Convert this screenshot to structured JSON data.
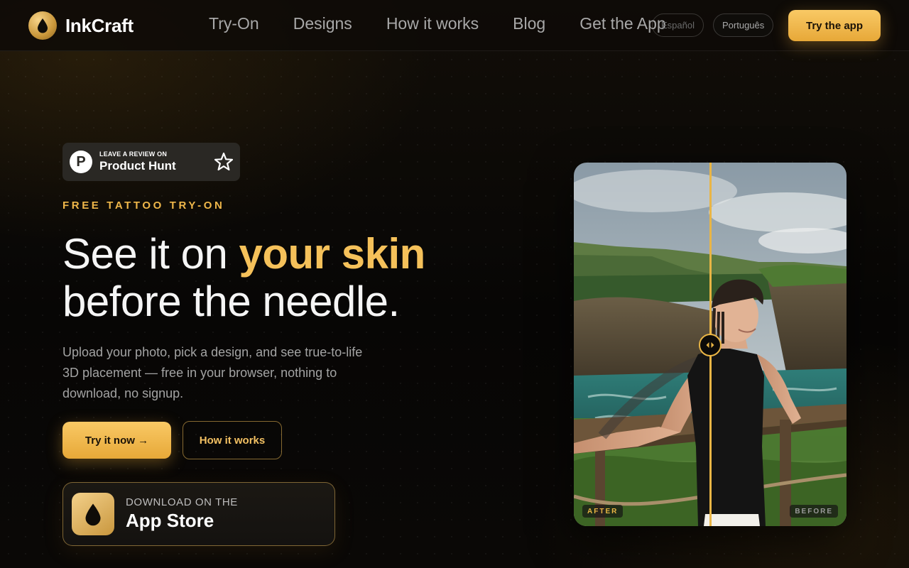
{
  "brand": {
    "name": "InkCraft",
    "icon": "ink-drop-icon"
  },
  "nav": {
    "links": [
      "Try-On",
      "Designs",
      "How it works",
      "Blog",
      "Get the App"
    ],
    "languages": [
      "Español",
      "Português"
    ],
    "cta": "Try the app"
  },
  "product_hunt": {
    "small": "LEAVE A REVIEW ON",
    "big": "Product Hunt",
    "letter": "P",
    "icon": "star-icon"
  },
  "hero": {
    "eyebrow": "FREE TATTOO TRY-ON",
    "headline_1": "See it on ",
    "headline_accent": "your skin",
    "headline_2": "before the needle.",
    "subtext": "Upload your photo, pick a design, and see true-to-life 3D placement — free in your browser, nothing to download, no signup.",
    "primary_cta": "Try it now →",
    "secondary_cta": "How it works"
  },
  "app_store": {
    "small": "DOWNLOAD ON THE",
    "big": "App Store",
    "icon": "ink-drop-icon"
  },
  "comparison": {
    "after_label": "AFTER",
    "before_label": "BEFORE",
    "slider_position": 0.5,
    "handle_icon": "double-arrow-icon"
  },
  "colors": {
    "accent": "#f5c15a",
    "background": "#0b0906",
    "button_gold": "#efb14a"
  }
}
